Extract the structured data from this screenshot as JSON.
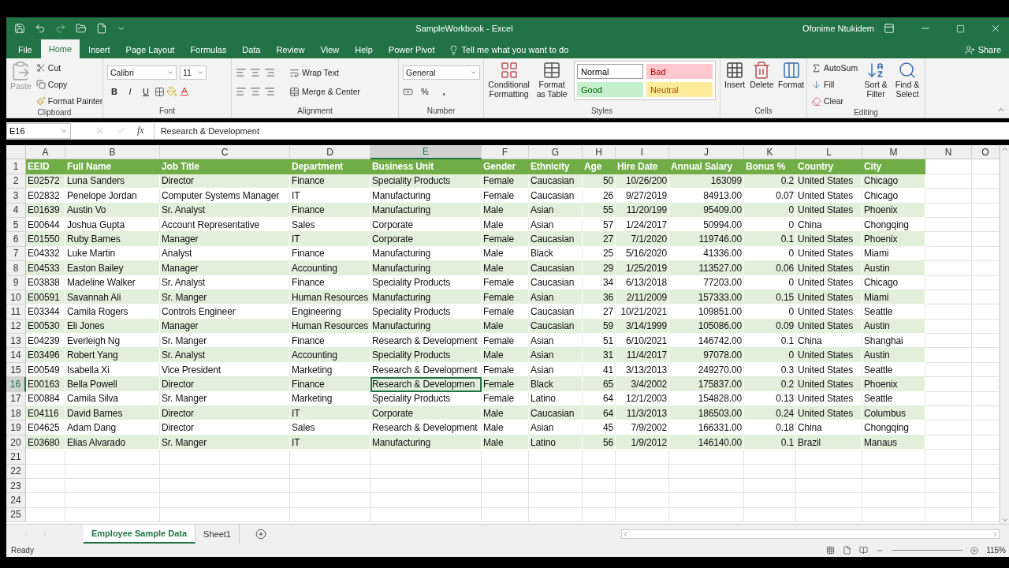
{
  "window": {
    "title": "SampleWorkbook  -  Excel",
    "user": "Ofonime Ntukidem"
  },
  "tabs": [
    {
      "label": "File",
      "selected": false
    },
    {
      "label": "Home",
      "selected": true
    },
    {
      "label": "Insert",
      "selected": false
    },
    {
      "label": "Page Layout",
      "selected": false
    },
    {
      "label": "Formulas",
      "selected": false
    },
    {
      "label": "Data",
      "selected": false
    },
    {
      "label": "Review",
      "selected": false
    },
    {
      "label": "View",
      "selected": false
    },
    {
      "label": "Help",
      "selected": false
    },
    {
      "label": "Power Pivot",
      "selected": false
    }
  ],
  "tell_me": "Tell me what you want to do",
  "share": "Share",
  "ribbon": {
    "clipboard": {
      "label": "Clipboard",
      "paste": "Paste",
      "cut": "Cut",
      "copy": "Copy",
      "format_painter": "Format Painter"
    },
    "font": {
      "label": "Font",
      "font_name": "Calibri",
      "font_size": "11",
      "bold": "B",
      "italic": "I",
      "underline": "U"
    },
    "alignment": {
      "label": "Alignment",
      "wrap_text": "Wrap Text",
      "merge": "Merge & Center"
    },
    "number": {
      "label": "Number",
      "format": "General",
      "percent": "%",
      "comma": ","
    },
    "styles": {
      "label": "Styles",
      "conditional": "Conditional Formatting",
      "format_table": "Format as Table",
      "cells": [
        {
          "label": "Normal",
          "color": "#ffffff"
        },
        {
          "label": "Bad",
          "color": "#ffc7ce"
        },
        {
          "label": "Good",
          "color": "#c6efce"
        },
        {
          "label": "Neutral",
          "color": "#ffeb9c"
        }
      ]
    },
    "cells": {
      "label": "Cells",
      "buttons": [
        "Insert",
        "Delete",
        "Format"
      ]
    },
    "editing": {
      "label": "Editing",
      "autosum": "AutoSum",
      "fill": "Fill",
      "clear": "Clear",
      "sort": "Sort & Filter",
      "find": "Find & Select"
    }
  },
  "formula_bar": {
    "name_box": "E16",
    "function_label": "fx",
    "formula": "Research & Development"
  },
  "columns": [
    {
      "letter": "A",
      "selected": false,
      "numeric": false
    },
    {
      "letter": "B",
      "selected": false,
      "numeric": false
    },
    {
      "letter": "C",
      "selected": false,
      "numeric": false
    },
    {
      "letter": "D",
      "selected": false,
      "numeric": false
    },
    {
      "letter": "E",
      "selected": true,
      "numeric": false
    },
    {
      "letter": "F",
      "selected": false,
      "numeric": false
    },
    {
      "letter": "G",
      "selected": false,
      "numeric": false
    },
    {
      "letter": "H",
      "selected": false,
      "numeric": true
    },
    {
      "letter": "I",
      "selected": false,
      "numeric": true
    },
    {
      "letter": "J",
      "selected": false,
      "numeric": true
    },
    {
      "letter": "K",
      "selected": false,
      "numeric": true
    },
    {
      "letter": "L",
      "selected": false,
      "numeric": false
    },
    {
      "letter": "M",
      "selected": false,
      "numeric": false
    },
    {
      "letter": "N",
      "selected": false
    },
    {
      "letter": "O",
      "selected": false
    }
  ],
  "rows": [
    {
      "number": "1",
      "kind": "header",
      "selected": false,
      "cells": [
        "EEID",
        "Full Name",
        "Job Title",
        "Department",
        "Business Unit",
        "Gender",
        "Ethnicity",
        "Age",
        "Hire Date",
        "Annual Salary",
        "Bonus %",
        "Country",
        "City"
      ]
    },
    {
      "number": "2",
      "kind": "data",
      "selected": false,
      "cells": [
        "E02572",
        "Luna Sanders",
        "Director",
        "Finance",
        "Speciality Products",
        "Female",
        "Caucasian",
        "50",
        "10/26/200",
        "163099",
        "0.2",
        "United States",
        "Chicago"
      ]
    },
    {
      "number": "3",
      "kind": "data",
      "selected": false,
      "cells": [
        "E02832",
        "Penelope Jordan",
        "Computer Systems Manager",
        "IT",
        "Manufacturing",
        "Female",
        "Caucasian",
        "26",
        "9/27/2019",
        "84913.00",
        "0.07",
        "United States",
        "Chicago"
      ]
    },
    {
      "number": "4",
      "kind": "data",
      "selected": false,
      "cells": [
        "E01639",
        "Austin Vo",
        "Sr. Analyst",
        "Finance",
        "Manufacturing",
        "Male",
        "Asian",
        "55",
        "11/20/199",
        "95409.00",
        "0",
        "United States",
        "Phoenix"
      ]
    },
    {
      "number": "5",
      "kind": "data",
      "selected": false,
      "cells": [
        "E00644",
        "Joshua Gupta",
        "Account Representative",
        "Sales",
        "Corporate",
        "Male",
        "Asian",
        "57",
        "1/24/2017",
        "50994.00",
        "0",
        "China",
        "Chongqing"
      ]
    },
    {
      "number": "6",
      "kind": "data",
      "selected": false,
      "cells": [
        "E01550",
        "Ruby Barnes",
        "Manager",
        "IT",
        "Corporate",
        "Female",
        "Caucasian",
        "27",
        "7/1/2020",
        "119746.00",
        "0.1",
        "United States",
        "Phoenix"
      ]
    },
    {
      "number": "7",
      "kind": "data",
      "selected": false,
      "cells": [
        "E04332",
        "Luke Martin",
        "Analyst",
        "Finance",
        "Manufacturing",
        "Male",
        "Black",
        "25",
        "5/16/2020",
        "41336.00",
        "0",
        "United States",
        "Miami"
      ]
    },
    {
      "number": "8",
      "kind": "data",
      "selected": false,
      "cells": [
        "E04533",
        "Easton Bailey",
        "Manager",
        "Accounting",
        "Manufacturing",
        "Male",
        "Caucasian",
        "29",
        "1/25/2019",
        "113527.00",
        "0.06",
        "United States",
        "Austin"
      ]
    },
    {
      "number": "9",
      "kind": "data",
      "selected": false,
      "cells": [
        "E03838",
        "Madeline Walker",
        "Sr. Analyst",
        "Finance",
        "Speciality Products",
        "Female",
        "Caucasian",
        "34",
        "6/13/2018",
        "77203.00",
        "0",
        "United States",
        "Chicago"
      ]
    },
    {
      "number": "10",
      "kind": "data",
      "selected": false,
      "cells": [
        "E00591",
        "Savannah Ali",
        "Sr. Manger",
        "Human Resources",
        "Manufacturing",
        "Female",
        "Asian",
        "36",
        "2/11/2009",
        "157333.00",
        "0.15",
        "United States",
        "Miami"
      ]
    },
    {
      "number": "11",
      "kind": "data",
      "selected": false,
      "cells": [
        "E03344",
        "Camila Rogers",
        "Controls Engineer",
        "Engineering",
        "Speciality Products",
        "Female",
        "Caucasian",
        "27",
        "10/21/2021",
        "109851.00",
        "0",
        "United States",
        "Seattle"
      ]
    },
    {
      "number": "12",
      "kind": "data",
      "selected": false,
      "cells": [
        "E00530",
        "Eli Jones",
        "Manager",
        "Human Resources",
        "Manufacturing",
        "Male",
        "Caucasian",
        "59",
        "3/14/1999",
        "105086.00",
        "0.09",
        "United States",
        "Austin"
      ]
    },
    {
      "number": "13",
      "kind": "data",
      "selected": false,
      "cells": [
        "E04239",
        "Everleigh Ng",
        "Sr. Manger",
        "Finance",
        "Research & Development",
        "Female",
        "Asian",
        "51",
        "6/10/2021",
        "146742.00",
        "0.1",
        "China",
        "Shanghai"
      ]
    },
    {
      "number": "14",
      "kind": "data",
      "selected": false,
      "cells": [
        "E03496",
        "Robert Yang",
        "Sr. Analyst",
        "Accounting",
        "Speciality Products",
        "Male",
        "Asian",
        "31",
        "11/4/2017",
        "97078.00",
        "0",
        "United States",
        "Austin"
      ]
    },
    {
      "number": "15",
      "kind": "data",
      "selected": false,
      "cells": [
        "E00549",
        "Isabella Xi",
        "Vice President",
        "Marketing",
        "Research & Development",
        "Female",
        "Asian",
        "41",
        "3/13/2013",
        "249270.00",
        "0.3",
        "United States",
        "Seattle"
      ]
    },
    {
      "number": "16",
      "kind": "data",
      "selected": true,
      "cells": [
        "E00163",
        "Bella Powell",
        "Director",
        "Finance",
        "Research & Developmen",
        "Female",
        "Black",
        "65",
        "3/4/2002",
        "175837.00",
        "0.2",
        "United States",
        "Phoenix"
      ]
    },
    {
      "number": "17",
      "kind": "data",
      "selected": false,
      "cells": [
        "E00884",
        "Camila Silva",
        "Sr. Manger",
        "Marketing",
        "Speciality Products",
        "Female",
        "Latino",
        "64",
        "12/1/2003",
        "154828.00",
        "0.13",
        "United States",
        "Seattle"
      ]
    },
    {
      "number": "18",
      "kind": "data",
      "selected": false,
      "cells": [
        "E04116",
        "David Barnes",
        "Director",
        "IT",
        "Corporate",
        "Male",
        "Caucasian",
        "64",
        "11/3/2013",
        "186503.00",
        "0.24",
        "United States",
        "Columbus"
      ]
    },
    {
      "number": "19",
      "kind": "data",
      "selected": false,
      "cells": [
        "E04625",
        "Adam Dang",
        "Director",
        "Sales",
        "Research & Development",
        "Male",
        "Asian",
        "45",
        "7/9/2002",
        "166331.00",
        "0.18",
        "China",
        "Chongqing"
      ]
    },
    {
      "number": "20",
      "kind": "data",
      "selected": false,
      "cells": [
        "E03680",
        "Elias Alvarado",
        "Sr. Manger",
        "IT",
        "Manufacturing",
        "Male",
        "Latino",
        "56",
        "1/9/2012",
        "146140.00",
        "0.1",
        "Brazil",
        "Manaus"
      ]
    },
    {
      "number": "21",
      "kind": "empty",
      "selected": false
    },
    {
      "number": "22",
      "kind": "empty",
      "selected": false
    },
    {
      "number": "23",
      "kind": "empty",
      "selected": false
    },
    {
      "number": "24",
      "kind": "empty",
      "selected": false
    },
    {
      "number": "25",
      "kind": "empty",
      "selected": false
    }
  ],
  "sheets": [
    {
      "label": "Employee Sample Data",
      "selected": true
    },
    {
      "label": "Sheet1",
      "selected": false
    }
  ],
  "status_bar": {
    "status": "Ready",
    "zoom": "115%"
  }
}
